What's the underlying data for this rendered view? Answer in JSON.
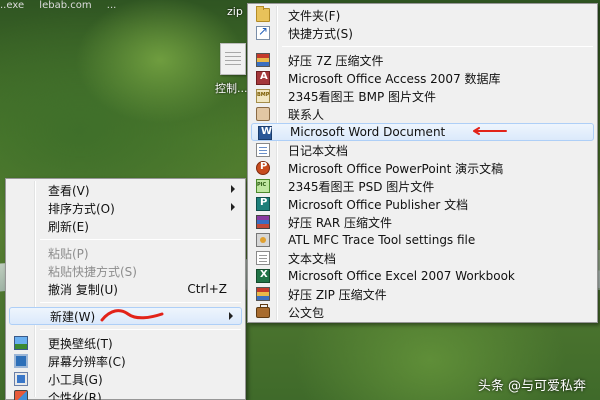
{
  "desktop": {
    "top_strip_fragments": [
      "..exe",
      "lebab.com",
      "..."
    ],
    "zip_label": "zip",
    "file_label": "控制..."
  },
  "context_menu": {
    "items": [
      {
        "label": "查看(V)",
        "has_submenu": true
      },
      {
        "label": "排序方式(O)",
        "has_submenu": true
      },
      {
        "label": "刷新(E)"
      },
      {
        "label": "粘贴(P)",
        "disabled": true
      },
      {
        "label": "粘贴快捷方式(S)",
        "disabled": true
      },
      {
        "label": "撤消 复制(U)",
        "shortcut": "Ctrl+Z"
      },
      {
        "label": "新建(W)",
        "has_submenu": true,
        "icon": "folder-icon"
      },
      {
        "label": "更换壁纸(T)",
        "icon": "wallpaper-icon"
      },
      {
        "label": "屏幕分辨率(C)",
        "icon": "screen-resolution-icon"
      },
      {
        "label": "小工具(G)",
        "icon": "gadget-icon"
      },
      {
        "label": "个性化(R)",
        "icon": "personalize-icon"
      }
    ]
  },
  "new_submenu": {
    "items": [
      {
        "label": "文件夹(F)",
        "icon": "folder-icon"
      },
      {
        "label": "快捷方式(S)",
        "icon": "shortcut-icon"
      },
      {
        "label": "好压 7Z 压缩文件",
        "icon": "archive-7z-icon"
      },
      {
        "label": "Microsoft Office Access 2007 数据库",
        "icon": "access-icon"
      },
      {
        "label": "2345看图王 BMP 图片文件",
        "icon": "bmp-image-icon"
      },
      {
        "label": "联系人",
        "icon": "contact-icon"
      },
      {
        "label": "Microsoft Word Document",
        "icon": "word-icon"
      },
      {
        "label": "日记本文档",
        "icon": "journal-icon"
      },
      {
        "label": "Microsoft Office PowerPoint 演示文稿",
        "icon": "powerpoint-icon"
      },
      {
        "label": "2345看图王 PSD 图片文件",
        "icon": "psd-image-icon"
      },
      {
        "label": "Microsoft Office Publisher 文档",
        "icon": "publisher-icon"
      },
      {
        "label": "好压 RAR 压缩文件",
        "icon": "archive-rar-icon"
      },
      {
        "label": "ATL MFC Trace Tool settings file",
        "icon": "settings-file-icon"
      },
      {
        "label": "文本文档",
        "icon": "text-document-icon"
      },
      {
        "label": "Microsoft Office Excel 2007 Workbook",
        "icon": "excel-icon"
      },
      {
        "label": "好压 ZIP 压缩文件",
        "icon": "archive-zip-icon"
      },
      {
        "label": "公文包",
        "icon": "briefcase-icon"
      }
    ]
  },
  "watermark": "头条 @与可爱私奔",
  "colors": {
    "annotation_red": "#e2231a",
    "highlight_border": "#aecff7",
    "menu_bg": "#f0f0f0"
  }
}
